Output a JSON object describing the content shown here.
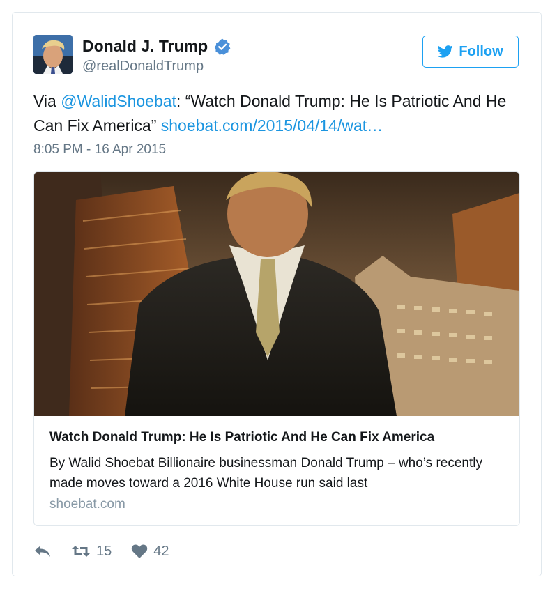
{
  "user": {
    "name": "Donald J. Trump",
    "handle": "@realDonaldTrump",
    "avatar_icon": "profile-photo"
  },
  "follow_button": {
    "label": "Follow",
    "icon": "twitter-bird-icon"
  },
  "tweet": {
    "prefix": "Via ",
    "mention": "@WalidShoebat",
    "body": ": “Watch Donald Trump: He Is Patriotic And He Can Fix America” ",
    "link": "shoebat.com/2015/04/14/wat…",
    "timestamp": "8:05 PM - 16 Apr 2015"
  },
  "media_card": {
    "title": "Watch Donald Trump: He Is Patriotic And He Can Fix America",
    "description": "By Walid Shoebat Billionaire businessman Donald Trump – who’s recently made moves toward a 2016 White House run said last",
    "domain": "shoebat.com"
  },
  "actions": {
    "reply_icon": "reply-icon",
    "retweet_icon": "retweet-icon",
    "retweet_count": "15",
    "like_icon": "heart-icon",
    "like_count": "42"
  },
  "colors": {
    "link": "#1b95e0",
    "follow_blue": "#1da1f2",
    "muted": "#657786",
    "border": "#e1e8ed"
  }
}
